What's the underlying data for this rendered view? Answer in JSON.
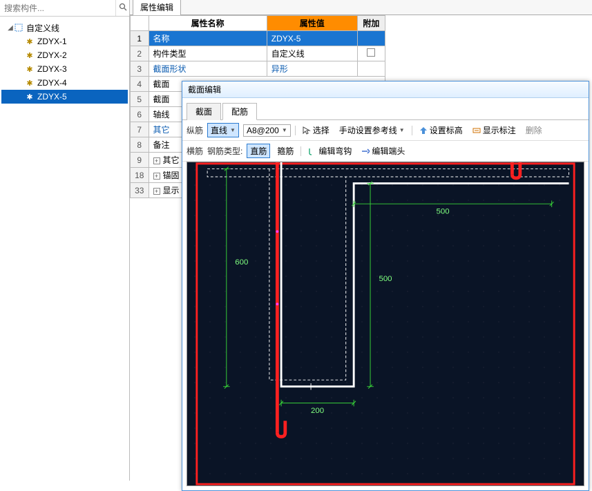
{
  "search": {
    "placeholder": "搜索构件..."
  },
  "tree": {
    "root_label": "自定义线",
    "items": [
      {
        "label": "ZDYX-1",
        "selected": false
      },
      {
        "label": "ZDYX-2",
        "selected": false
      },
      {
        "label": "ZDYX-3",
        "selected": false
      },
      {
        "label": "ZDYX-4",
        "selected": false
      },
      {
        "label": "ZDYX-5",
        "selected": true
      }
    ]
  },
  "prop_panel": {
    "tab": "属性编辑",
    "headers": {
      "name": "属性名称",
      "value": "属性值",
      "extra": "附加"
    },
    "rows": [
      {
        "num": "1",
        "name": "名称",
        "value": "ZDYX-5",
        "selected": true
      },
      {
        "num": "2",
        "name": "构件类型",
        "value": "自定义线",
        "checkbox": true
      },
      {
        "num": "3",
        "name": "截面形状",
        "value": "异形",
        "blue": true
      },
      {
        "num": "4",
        "name": "截面"
      },
      {
        "num": "5",
        "name": "截面"
      },
      {
        "num": "6",
        "name": "轴线"
      },
      {
        "num": "7",
        "name": "其它",
        "blue": true
      },
      {
        "num": "8",
        "name": "备注"
      },
      {
        "num": "9",
        "name": "其它",
        "expand": true
      },
      {
        "num": "18",
        "name": "锚固",
        "expand": true
      },
      {
        "num": "33",
        "name": "显示",
        "expand": true
      }
    ]
  },
  "section_editor": {
    "title": "截面编辑",
    "tabs": {
      "section": "截面",
      "rebar": "配筋"
    },
    "toolbar1": {
      "vertical": "纵筋",
      "line": "直线",
      "spec": "A8@200",
      "select": "选择",
      "ref_line": "手动设置参考线",
      "set_elev": "设置标高",
      "show_annot": "显示标注",
      "delete": "删除"
    },
    "toolbar2": {
      "horiz": "横筋",
      "rebar_type_lbl": "钢筋类型:",
      "straight": "直筋",
      "stirrup": "箍筋",
      "edit_hook": "编辑弯钩",
      "edit_end": "编辑端头"
    },
    "dims": {
      "d600": "600",
      "d500_top": "500",
      "d500_side": "500",
      "d200": "200"
    }
  }
}
